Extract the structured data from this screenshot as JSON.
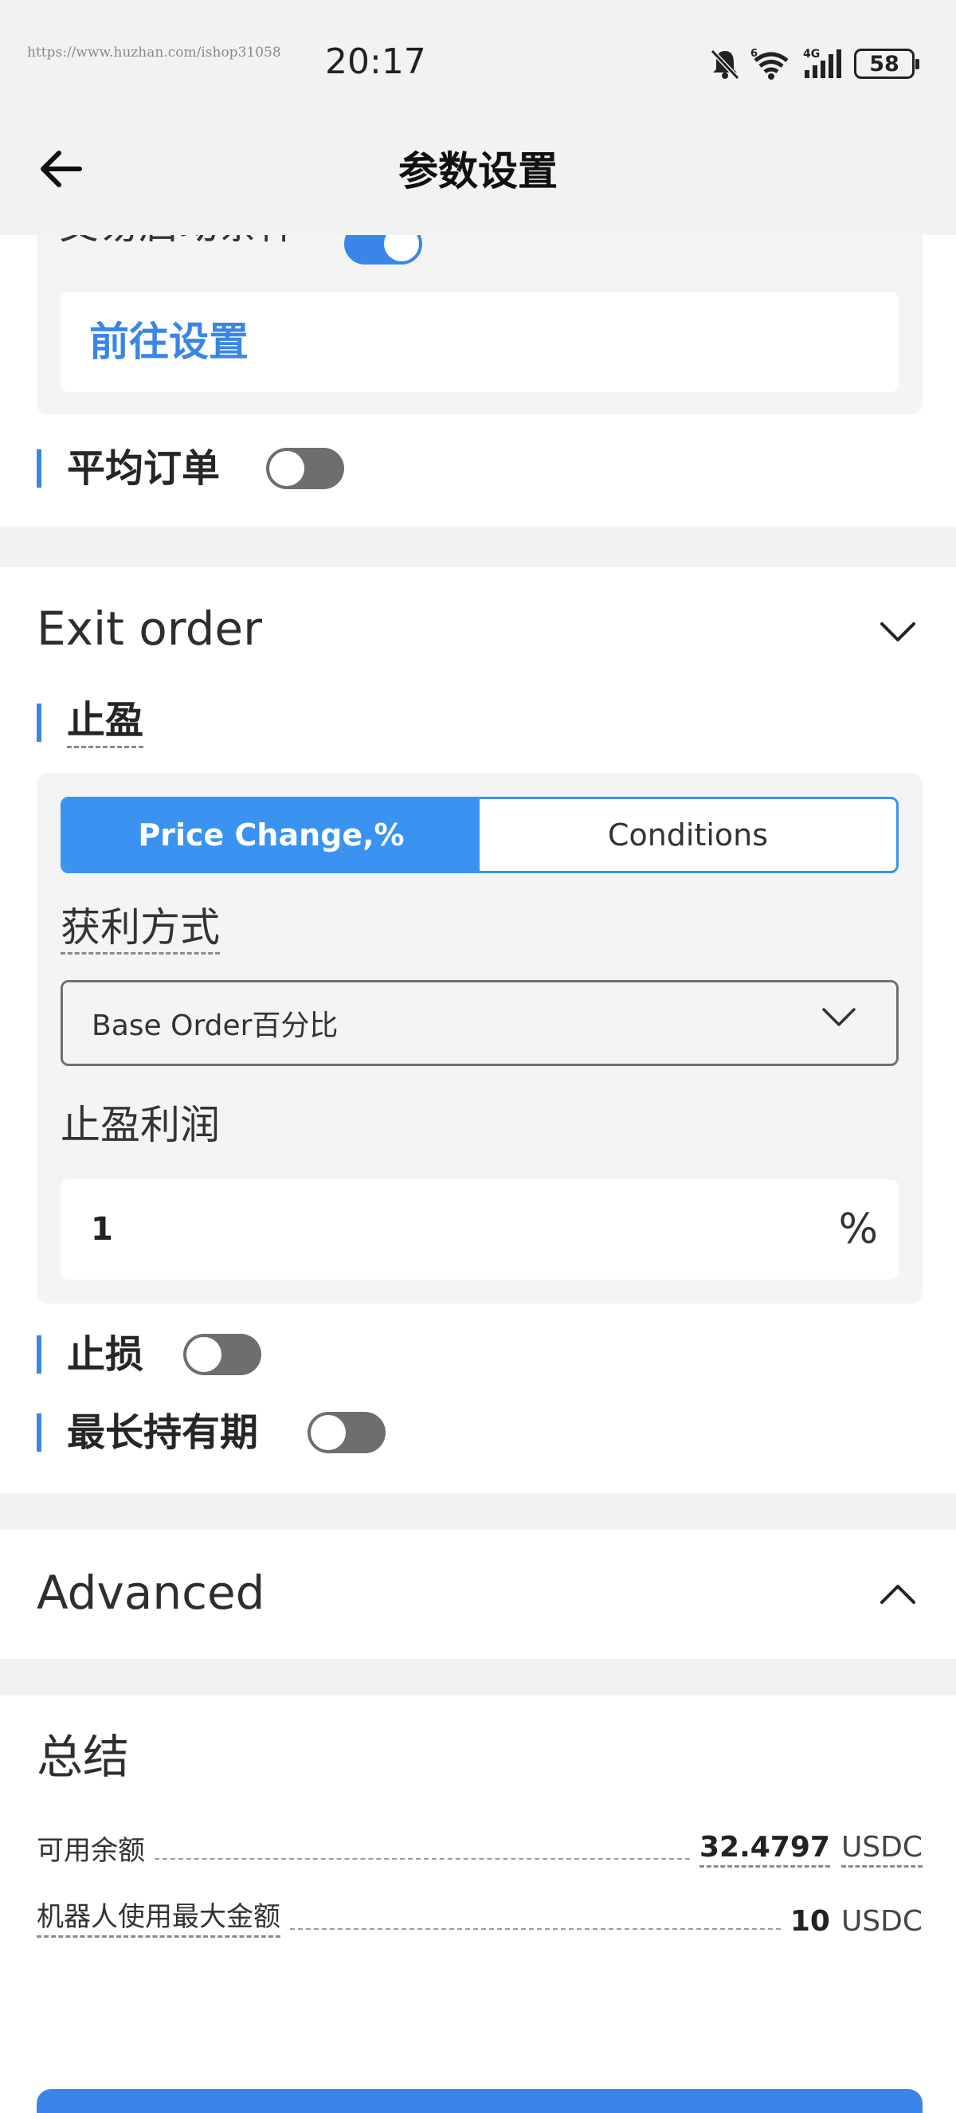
{
  "status_bar": {
    "watermark": "https://www.huzhan.com/ishop31058",
    "time": "20:17",
    "signal_label": "4G",
    "wifi_label": "6",
    "battery": "58"
  },
  "header": {
    "title": "参数设置"
  },
  "start_section": {
    "cut_label": "交易启动条件",
    "toggle_on": true,
    "link": "前往设置"
  },
  "average_order": {
    "label": "平均订单",
    "toggle_on": false
  },
  "exit_order": {
    "title": "Exit order",
    "take_profit_label": "止盈",
    "segments": [
      "Price Change,%",
      "Conditions"
    ],
    "active_segment": 0,
    "profit_method_label": "获利方式",
    "profit_method_value": "Base Order百分比",
    "profit_label": "止盈利润",
    "profit_value": "1",
    "profit_unit": "%",
    "stop_loss_label": "止损",
    "stop_loss_on": false,
    "max_hold_label": "最长持有期",
    "max_hold_on": false
  },
  "advanced": {
    "title": "Advanced"
  },
  "summary": {
    "title": "总结",
    "rows": [
      {
        "label": "可用余额",
        "value": "32.4797",
        "currency": "USDC"
      },
      {
        "label": "机器人使用最大金额",
        "value": "10",
        "currency": "USDC"
      }
    ]
  },
  "colors": {
    "accent": "#3a86e8",
    "segment_active": "#3a93f0",
    "toggle_off": "#6e6e6e"
  }
}
